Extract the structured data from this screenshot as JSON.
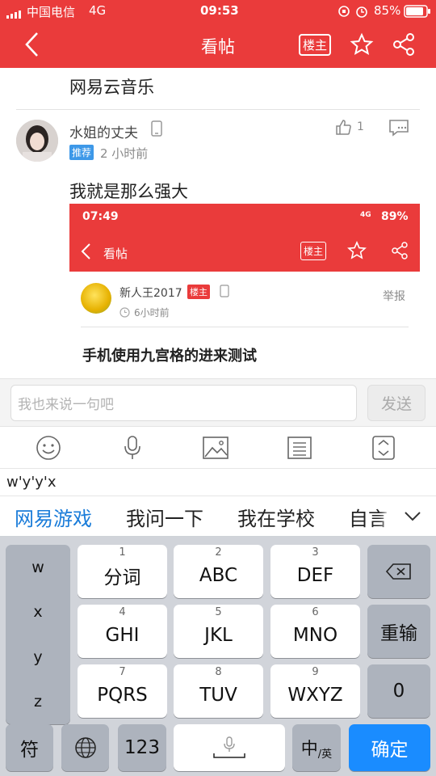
{
  "status_bar": {
    "carrier": "中国电信",
    "network": "4G",
    "time": "09:53",
    "battery": "85%"
  },
  "nav": {
    "back_icon": "chevron-left-icon",
    "title": "看帖",
    "owner_badge": "楼主"
  },
  "post": {
    "title_text": "网易云音乐"
  },
  "reply": {
    "username": "水姐的丈夫",
    "tag": "推荐",
    "time_ago": "2 小时前",
    "like_count": "1",
    "text": "我就是那么强大"
  },
  "embedded": {
    "time": "07:49",
    "signal": "4G",
    "battery": "89%",
    "title": "看帖",
    "owner_badge": "楼主",
    "author": "新人王2017",
    "author_badge": "楼主",
    "time_ago": "6小时前",
    "report": "举报",
    "post_title": "手机使用九宫格的进来测试"
  },
  "comment": {
    "placeholder": "我也来说一句吧",
    "send_label": "发送"
  },
  "ime": {
    "composition": "w'y'y'x",
    "candidates": [
      "网易游戏",
      "我问一下",
      "我在学校",
      "自言"
    ],
    "active_candidate_color": "#1a7cd9",
    "left_column": [
      "w",
      "x",
      "y",
      "z"
    ],
    "keys": [
      {
        "sub": "1",
        "label": "分词"
      },
      {
        "sub": "2",
        "label": "ABC"
      },
      {
        "sub": "3",
        "label": "DEF"
      },
      {
        "sub": "4",
        "label": "GHI"
      },
      {
        "sub": "5",
        "label": "JKL"
      },
      {
        "sub": "6",
        "label": "MNO"
      },
      {
        "sub": "7",
        "label": "PQRS"
      },
      {
        "sub": "8",
        "label": "TUV"
      },
      {
        "sub": "9",
        "label": "WXYZ"
      }
    ],
    "right_keys": {
      "delete_icon": "backspace-icon",
      "retype": "重输",
      "zero": "0"
    },
    "bottom": {
      "symbol": "符",
      "globe_icon": "globe-icon",
      "num": "123",
      "mic_icon": "mic-icon",
      "lang": "中",
      "lang_sub": "/英",
      "confirm": "确定"
    }
  },
  "colors": {
    "brand_red": "#ea3b3b",
    "confirm_blue": "#1a8cff",
    "tag_blue": "#3d98e8"
  }
}
